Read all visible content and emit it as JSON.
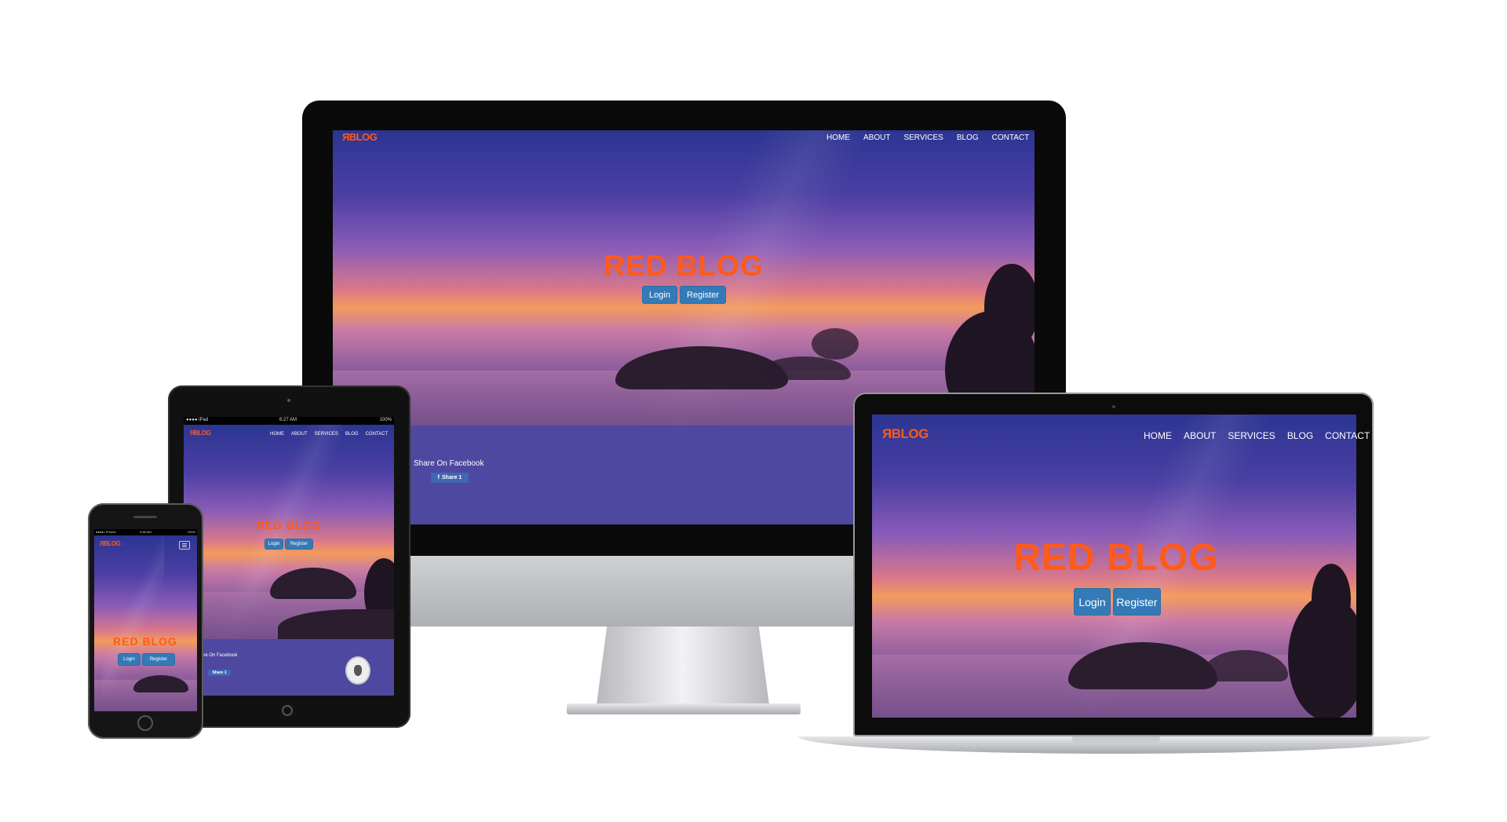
{
  "site": {
    "brand": "ЯBLOG",
    "title": "RED BLOG",
    "nav": [
      "HOME",
      "ABOUT",
      "SERVICES",
      "BLOG",
      "CONTACT"
    ],
    "login_label": "Login",
    "register_label": "Register",
    "share_heading": "Share On Facebook",
    "share_short": "are On Facebook",
    "share_button": "Share 1"
  },
  "ipad_status": {
    "carrier": "●●●● iPad",
    "time": "6:27 AM",
    "battery": "100%"
  },
  "iphone_status": {
    "carrier": "●●●●○ iPhone",
    "time": "9:46 AM",
    "battery": "100%"
  },
  "colors": {
    "brand": "#ff5a1a",
    "button": "#337ab7",
    "strip": "#4e48a0"
  },
  "icons": [
    "hamburger-icon",
    "lion-logo-icon",
    "facebook-icon"
  ]
}
